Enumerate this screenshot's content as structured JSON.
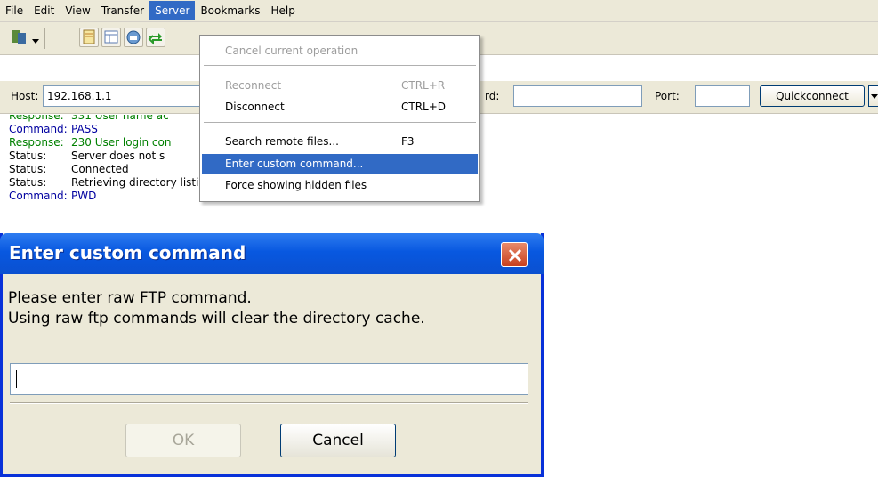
{
  "menubar": {
    "items": [
      "File",
      "Edit",
      "View",
      "Transfer",
      "Server",
      "Bookmarks",
      "Help"
    ],
    "active": "Server"
  },
  "toolbar": {
    "icons": [
      "site-manager-icon",
      "dropdown-arrow-icon",
      "toggle-log-icon",
      "toggle-tree-icon",
      "toggle-queue-icon",
      "sync-icon"
    ]
  },
  "quickconnect": {
    "host_label": "Host:",
    "host_value": "192.168.1.1",
    "password_label_partial": "rd:",
    "password_value": "",
    "port_label": "Port:",
    "port_value": "",
    "button_label": "Quickconnect"
  },
  "log": [
    {
      "key": "Response:",
      "text": "331 User name ac",
      "color": "#008000"
    },
    {
      "key": "Command:",
      "text": "PASS",
      "color": "#0000a0"
    },
    {
      "key": "Response:",
      "text": "230 User login con",
      "color": "#008000"
    },
    {
      "key": "Status:",
      "text": "Server does not s",
      "color": "#000000"
    },
    {
      "key": "Status:",
      "text": "Connected",
      "color": "#000000"
    },
    {
      "key": "Status:",
      "text": "Retrieving directory listing...",
      "color": "#000000"
    },
    {
      "key": "Command:",
      "text": "PWD",
      "color": "#0000a0"
    }
  ],
  "server_menu": {
    "cancel": "Cancel current operation",
    "reconnect": "Reconnect",
    "reconnect_shortcut": "CTRL+R",
    "disconnect": "Disconnect",
    "disconnect_shortcut": "CTRL+D",
    "search": "Search remote files...",
    "search_shortcut": "F3",
    "custom_command": "Enter custom command...",
    "force_hidden": "Force showing hidden files"
  },
  "dialog": {
    "title": "Enter custom command",
    "line1": "Please enter raw FTP command.",
    "line2": "Using raw ftp commands will clear the directory cache.",
    "input_value": "",
    "ok_label": "OK",
    "cancel_label": "Cancel"
  }
}
